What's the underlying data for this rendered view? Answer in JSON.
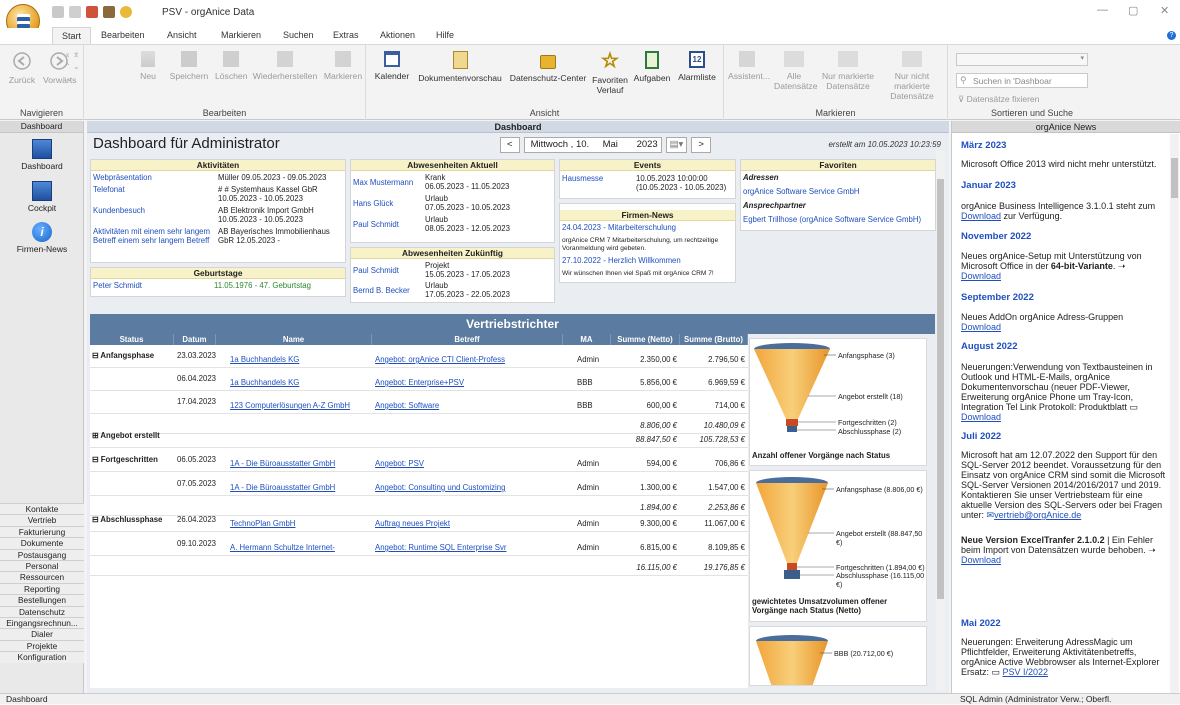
{
  "window": {
    "title": "PSV - orgAnice Data",
    "controls": [
      "—",
      "▢",
      "✕"
    ]
  },
  "menu_tabs": [
    "Start",
    "Bearbeiten",
    "Ansicht",
    "Markieren",
    "Suchen",
    "Extras",
    "Aktionen",
    "Hilfe"
  ],
  "ribbon": {
    "groups": [
      "Navigieren",
      "Bearbeiten",
      "Ansicht",
      "Markieren",
      "Sortieren und Suche"
    ],
    "nav": [
      "Zurück",
      "Vorwärts"
    ],
    "edit": [
      "Neu",
      "Speichern",
      "Löschen",
      "Wiederherstellen",
      "Markieren"
    ],
    "view": [
      "Kalender",
      "Dokumentenvorschau",
      "Datenschutz-Center",
      "Favoriten Verlauf",
      "Aufgaben",
      "Alarmliste"
    ],
    "mark": [
      "Assistent...",
      "Alle Datensätze",
      "Nur markierte Datensätze",
      "Nur nicht markierte Datensätze"
    ],
    "search_placeholder": "Suchen in 'Dashboar",
    "fix_records": "Datensätze fixieren",
    "alarm_day": "12"
  },
  "left_nav": {
    "header": "Dashboard",
    "items": [
      "Dashboard",
      "Cockpit",
      "Firmen-News"
    ],
    "modules": [
      "Kontakte",
      "Vertrieb",
      "Fakturierung",
      "Dokumente",
      "Postausgang",
      "Personal",
      "Ressourcen",
      "Reporting",
      "Bestellungen",
      "Datenschutz",
      "Eingangsrechnun...",
      "Dialer",
      "Projekte",
      "Konfiguration"
    ]
  },
  "dashboard": {
    "header": "Dashboard",
    "title": "Dashboard für Administrator",
    "date": {
      "prev": "<",
      "weekday": "Mittwoch , 10.",
      "month": "Mai",
      "year": "2023",
      "next": ">"
    },
    "created": "erstellt am 10.05.2023 10:23:59",
    "aktivitaeten": {
      "title": "Aktivitäten",
      "rows": [
        {
          "name": "Webpräsentation",
          "l1": "Müller 09.05.2023 - 09.05.2023",
          "l2": ""
        },
        {
          "name": "Telefonat",
          "l1": "# # Systemhaus Kassel GbR",
          "l2": "10.05.2023 - 10.05.2023"
        },
        {
          "name": "Kundenbesuch",
          "l1": "AB Elektronik Import GmbH",
          "l2": "10.05.2023 - 10.05.2023"
        },
        {
          "name": "Aktivitäten mit einem sehr langem",
          "l1": "AB Bayerisches Immobilienhaus",
          "l2": ""
        },
        {
          "name": "Betreff einem sehr langem Betreff",
          "l1": "GbR 12.05.2023 -",
          "l2": ""
        }
      ]
    },
    "geburtstage": {
      "title": "Geburtstage",
      "name": "Peter Schmidt",
      "value": "11.05.1976 - 47. Geburtstag"
    },
    "abwesend_aktuell": {
      "title": "Abwesenheiten Aktuell",
      "rows": [
        {
          "name": "Max Mustermann",
          "type": "Krank",
          "dates": "06.05.2023 - 11.05.2023"
        },
        {
          "name": "Hans Glück",
          "type": "Urlaub",
          "dates": "07.05.2023 - 10.05.2023"
        },
        {
          "name": "Paul Schmidt",
          "type": "Urlaub",
          "dates": "08.05.2023 - 12.05.2023"
        }
      ]
    },
    "abwesend_zukuenftig": {
      "title": "Abwesenheiten Zukünftig",
      "rows": [
        {
          "name": "Paul Schmidt",
          "type": "Projekt",
          "dates": "15.05.2023 - 17.05.2023"
        },
        {
          "name": "Bernd B. Becker",
          "type": "Urlaub",
          "dates": "17.05.2023 - 22.05.2023"
        }
      ]
    },
    "events": {
      "title": "Events",
      "name": "Hausmesse",
      "l1": "10.05.2023 10:00:00",
      "l2": "(10.05.2023 - 10.05.2023)"
    },
    "firmen_news": {
      "title": "Firmen-News",
      "items": [
        {
          "head": "24.04.2023 - Mitarbeiterschulung",
          "text1": "orgAnice CRM 7 Mitarbeiterschulung, um rechtzeitige",
          "text2": "Voranmeldung wird gebeten."
        },
        {
          "head": "27.10.2022 - Herzlich Willkommen",
          "text1": "Wir wünschen Ihnen viel Spaß mit orgAnice CRM 7!",
          "text2": ""
        }
      ]
    },
    "favoriten": {
      "title": "Favoriten",
      "sections": [
        {
          "label": "Adressen",
          "entry": "orgAnice Software Service GmbH"
        },
        {
          "label": "Ansprechpartner",
          "entry": "Egbert Trillhose (orgAnice Software Service GmbH)"
        }
      ]
    }
  },
  "vertrieb": {
    "title": "Vertriebstrichter",
    "columns": [
      "Status",
      "Datum",
      "Name",
      "Betreff",
      "MA",
      "Summe (Netto)",
      "Summe (Brutto)"
    ],
    "rows": [
      {
        "status": "⊟ Anfangsphase",
        "datum": "23.03.2023",
        "name": "1a Buchhandels KG",
        "betreff": "Angebot:  orgAnice CTI Client-Profess",
        "ma": "Admin",
        "netto": "2.350,00 €",
        "brutto": "2.796,50 €"
      },
      {
        "status": "",
        "datum": "06.04.2023",
        "name": "1a Buchhandels KG",
        "betreff": "Angebot: Enterprise+PSV",
        "ma": "BBB",
        "netto": "5.856,00 €",
        "brutto": "6.969,59 €"
      },
      {
        "status": "",
        "datum": "17.04.2023",
        "name": "123 Computerlösungen A-Z GmbH",
        "betreff": "Angebot: Software",
        "ma": "BBB",
        "netto": "600,00 €",
        "brutto": "714,00 €"
      },
      {
        "status": "",
        "datum": "",
        "name": "",
        "betreff": "",
        "ma": "",
        "netto": "8.806,00 €",
        "brutto": "10.480,09 €"
      },
      {
        "status": "⊞ Angebot erstellt",
        "datum": "",
        "name": "",
        "betreff": "",
        "ma": "",
        "netto": "88.847,50 €",
        "brutto": "105.728,53 €"
      },
      {
        "status": "⊟ Fortgeschritten",
        "datum": "06.05.2023",
        "name": "1A - Die Büroausstatter GmbH",
        "betreff": "Angebot:  PSV",
        "ma": "Admin",
        "netto": "594,00 €",
        "brutto": "706,86 €"
      },
      {
        "status": "",
        "datum": "07.05.2023",
        "name": "1A - Die Büroausstatter GmbH",
        "betreff": "Angebot: Consulting und Customizing",
        "ma": "Admin",
        "netto": "1.300,00 €",
        "brutto": "1.547,00 €"
      },
      {
        "status": "",
        "datum": "",
        "name": "",
        "betreff": "",
        "ma": "",
        "netto": "1.894,00 €",
        "brutto": "2.253,86 €"
      },
      {
        "status": "⊟ Abschlussphase",
        "datum": "26.04.2023",
        "name": "TechnoPlan GmbH",
        "betreff": "Auftrag neues Projekt",
        "ma": "Admin",
        "netto": "9.300,00 €",
        "brutto": "11.067,00 €"
      },
      {
        "status": "",
        "datum": "09.10.2023",
        "name": "A. Hermann Schultze Internet-",
        "betreff": "Angebot: Runtime SQL Enterprise Svr",
        "ma": "Admin",
        "netto": "6.815,00 €",
        "brutto": "8.109,85 €"
      },
      {
        "status": "",
        "datum": "",
        "name": "",
        "betreff": "",
        "ma": "",
        "netto": "16.115,00 €",
        "brutto": "19.176,85 €"
      }
    ],
    "funnel1": {
      "labels": [
        "Anfangsphase (3)",
        "Angebot erstellt (18)",
        "Fortgeschritten (2)",
        "Abschlussphase (2)"
      ],
      "caption": "Anzahl offener Vorgänge nach Status"
    },
    "funnel2": {
      "labels": [
        "Anfangsphase (8.806,00 €)",
        "Angebot erstellt (88.847,50 €)",
        "Fortgeschritten (1.894,00 €)",
        "Abschlussphase (16.115,00 €)"
      ],
      "caption1": "gewichtetes Umsatzvolumen offener",
      "caption2": "Vorgänge nach Status (Netto)"
    },
    "funnel3": {
      "labels": [
        "BBB (20.712,00 €)"
      ]
    }
  },
  "news": {
    "header": "orgAnice News",
    "entries": [
      {
        "head": "März 2023",
        "text": "Microsoft Office 2013 wird nicht mehr unterstützt."
      },
      {
        "head": "Januar 2023",
        "text": "orgAnice Business Intelligence 3.1.0.1 steht zum",
        "link": "Download",
        "tail": " zur Verfügung."
      },
      {
        "head": "November 2022",
        "text": "Neues orgAnice-Setup mit Unterstützung von Microsoft Office in der ",
        "bold": "64-bit-Variante",
        "link": "Download"
      },
      {
        "head": "September 2022",
        "text": "Neues AddOn orgAnice Adress-Gruppen",
        "link": "Download"
      },
      {
        "head": "August 2022",
        "text": "Neuerungen:Verwendung von Textbausteinen in Outlook und HTML-E-Mails, orgAnice Dokumentenvorschau (neuer PDF-Viewer, Erweiterung orgAnice Phone um Tray-Icon, Integration Tel Link Protokoll: Produktblatt",
        "link": "Download"
      },
      {
        "head": "Juli 2022",
        "text": "Microsoft hat am 12.07.2022 den Support für den SQL-Server 2012 beendet. Voraussetzung für den Einsatz von orgAnice CRM sind somit die Microsoft SQL-Server Versionen 2014/2016/2017 und 2019. Kontaktieren Sie unser Vertriebsteam für eine aktuelle Version des SQL-Servers oder bei Fragen unter:",
        "link": "vertrieb@orgAnice.de"
      },
      {
        "head": "Neue Version ExcelTranfer 2.1.0.2",
        "text": " | Ein Fehler beim Import von Datensätzen wurde behoben.",
        "link": "Download"
      },
      {
        "head": "Mai 2022",
        "text": "Neuerungen: Erweiterung AdressMagic um Pflichtfelder, Erweiterung Aktivitätenbetreffs, orgAnice Active Webbrowser als Internet-Explorer Ersatz:",
        "link": "PSV I/2022"
      }
    ]
  },
  "statusbar": {
    "left": "Dashboard",
    "right": "SQL Admin (Administrator Verw.; Oberfl."
  },
  "colors": {
    "accent": "#5b7ba0",
    "link": "#1f4fbf",
    "panel_header": "#f7f2c8",
    "funnel": "#f5b942",
    "funnel_bottom": "#3a5f8c"
  }
}
